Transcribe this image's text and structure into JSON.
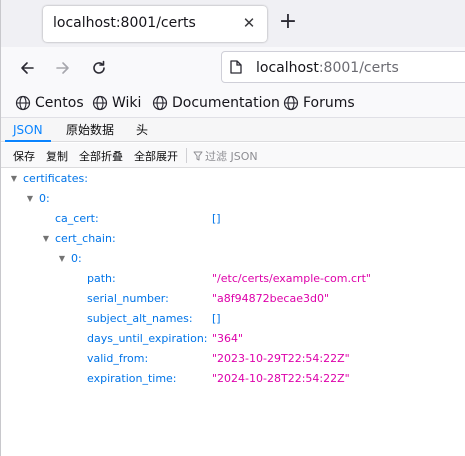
{
  "browser": {
    "tab_title": "localhost:8001/certs",
    "url_host": "localhost",
    "url_rest": ":8001/certs",
    "bookmarks": [
      "Centos",
      "Wiki",
      "Documentation",
      "Forums"
    ]
  },
  "viewer": {
    "tabs": [
      "JSON",
      "原始数据",
      "头"
    ],
    "active_tab": "JSON",
    "toolbar": {
      "save": "保存",
      "copy": "复制",
      "collapse_all": "全部折叠",
      "expand_all": "全部展开",
      "filter_placeholder": "过滤 JSON"
    }
  },
  "tree": {
    "root_key": "certificates:",
    "index0": "0:",
    "ca_cert_key": "ca_cert:",
    "ca_cert_val": "[]",
    "cert_chain_key": "cert_chain:",
    "chain_index0": "0:",
    "fields": [
      {
        "key": "path:",
        "value": "\"/etc/certs/example-com.crt\"",
        "kind": "str"
      },
      {
        "key": "serial_number:",
        "value": "\"a8f94872becae3d0\"",
        "kind": "str"
      },
      {
        "key": "subject_alt_names:",
        "value": "[]",
        "kind": "arr"
      },
      {
        "key": "days_until_expiration:",
        "value": "\"364\"",
        "kind": "str"
      },
      {
        "key": "valid_from:",
        "value": "\"2023-10-29T22:54:22Z\"",
        "kind": "str"
      },
      {
        "key": "expiration_time:",
        "value": "\"2024-10-28T22:54:22Z\"",
        "kind": "str"
      }
    ]
  },
  "colors": {
    "key": "#0074e8",
    "string": "#dd00a9",
    "accent": "#0a84ff"
  }
}
